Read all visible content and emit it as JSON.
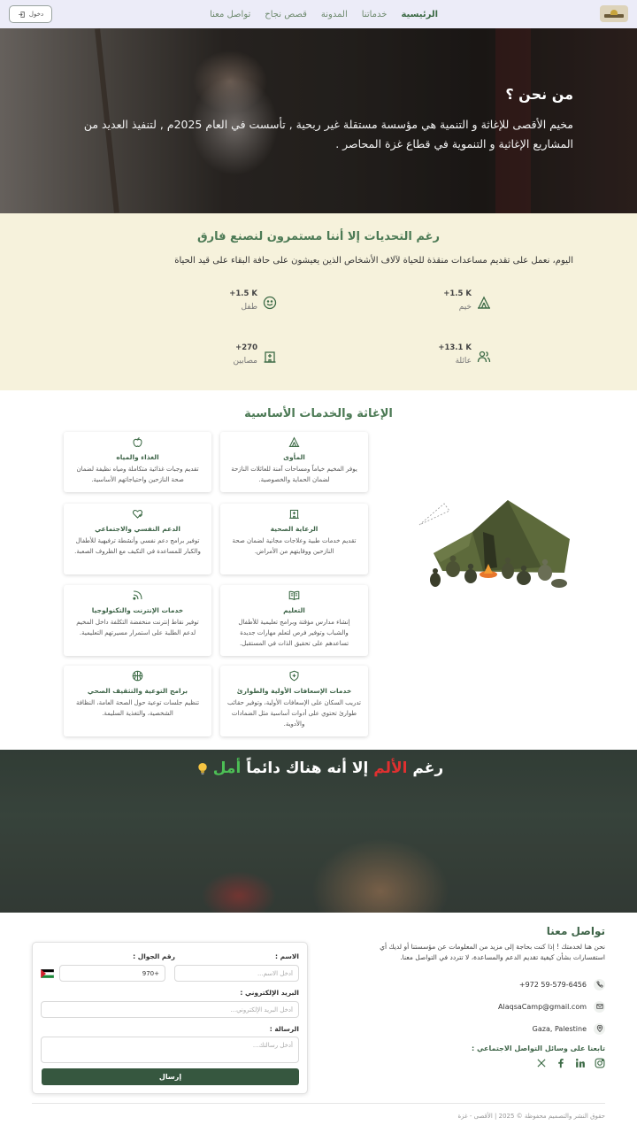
{
  "nav": {
    "links": [
      "الرئيسية",
      "خدماتنا",
      "المدونة",
      "قصص نجاح",
      "تواصل معنا"
    ],
    "login": "دخول"
  },
  "hero": {
    "title": "من نحن ؟",
    "text": "مخيم الأقصى للإغاثة و التنمية هي مؤسسة مستقلة غير ربحية , تأسست في العام 2025م , لتنفيذ العديد من المشاريع الإغاثية و التنموية في قطاع غزة المحاصر ."
  },
  "stats": {
    "title": "رغم التحديات إلا أننا مستمرون لنصنع فارق",
    "subtitle": "اليوم، نعمل على تقديم مساعدات منقذة للحياة لآلاف الأشخاص الذين يعيشون على حافة البقاء على قيد الحياة",
    "items": [
      {
        "value": "+1.5 K",
        "label": "خيم",
        "icon": "tent-icon"
      },
      {
        "value": "+1.5 K",
        "label": "طفل",
        "icon": "smile-icon"
      },
      {
        "value": "+13.1 K",
        "label": "عائلة",
        "icon": "family-icon"
      },
      {
        "value": "+270",
        "label": "مصابين",
        "icon": "hospital-icon"
      }
    ]
  },
  "services": {
    "title": "الإغاثة والخدمات الأساسية",
    "cards": [
      {
        "title": "المأوى",
        "desc": "يوفر المخيم خياماً ومساحات آمنة للعائلات النازحة لضمان الحماية والخصوصية.",
        "icon": "tent-icon"
      },
      {
        "title": "الغذاء والمياه",
        "desc": "تقديم وجبات غذائية متكاملة ومياه نظيفة لضمان صحة النازحين واحتياجاتهم الأساسية.",
        "icon": "apple-icon"
      },
      {
        "title": "الرعاية الصحية",
        "desc": "تقديم خدمات طبية وعلاجات مجانية لضمان صحة النازحين ووقايتهم من الأمراض.",
        "icon": "hospital-icon"
      },
      {
        "title": "الدعم النفسي والاجتماعي",
        "desc": "توفير برامج دعم نفسي وأنشطة ترفيهية للأطفال والكبار للمساعدة في التكيف مع الظروف الصعبة.",
        "icon": "heart-hand-icon"
      },
      {
        "title": "التعليم",
        "desc": "إنشاء مدارس مؤقتة وبرامج تعليمية للأطفال والشباب وتوفير فرص لتعلم مهارات جديدة تساعدهم على تحقيق الذات في المستقبل.",
        "icon": "book-icon"
      },
      {
        "title": "خدمات الإنترنت والتكنولوجيا",
        "desc": "توفير نقاط إنترنت منخفضة التكلفة داخل المخيم لدعم الطلبة على استمرار مسيرتهم التعليمية.",
        "icon": "rss-icon"
      },
      {
        "title": "خدمات الإسعافات الأولية والطوارئ",
        "desc": "تدريب السكان على الإسعافات الأولية، وتوفير حقائب طوارئ تحتوي على أدوات أساسية مثل الضمادات والأدوية.",
        "icon": "shield-plus-icon"
      },
      {
        "title": "برامج التوعية والتثقيف الصحي",
        "desc": "تنظيم جلسات توعية حول الصحة العامة، النظافة الشخصية، والتغذية السليمة.",
        "icon": "basketball-icon"
      }
    ]
  },
  "hope": {
    "part1": "رغم",
    "pain": "الألم",
    "part2": "إلا أنه هناك دائماً",
    "hope_word": "أمل"
  },
  "contact": {
    "title": "تواصل معنا",
    "text": "نحن هنا لخدمتك ! إذا كنت بحاجة إلى مزيد من المعلومات عن مؤسستنا أو لديك أي استفسارات بشأن كيفية تقديم الدعم والمساعدة، لا تتردد في التواصل معنا.",
    "phone": "+972 59-579-6456",
    "email": "AlaqsaCamp@gmail.com",
    "address": "Gaza, Palestine",
    "follow": "تابعنا على وسائل التواصل الاجتماعي :",
    "copyright": "حقوق النشر والتصميم محفوظة © 2025 | الأقصى - غزة"
  },
  "form": {
    "name_label": "الاسم :",
    "name_placeholder": "أدخل الاسم...",
    "phone_label": "رقم الجوال :",
    "phone_code": "+970",
    "email_label": "البريد الإلكتروني :",
    "email_placeholder": "أدخل البريد الإلكتروني...",
    "message_label": "الرسالة :",
    "message_placeholder": "أدخل رسالتك...",
    "submit": "إرسال"
  },
  "colors": {
    "brand_green": "#3d6b46",
    "stats_bg": "#f6f2dc",
    "nav_bg": "#ececf8",
    "button_green": "#36573f"
  }
}
